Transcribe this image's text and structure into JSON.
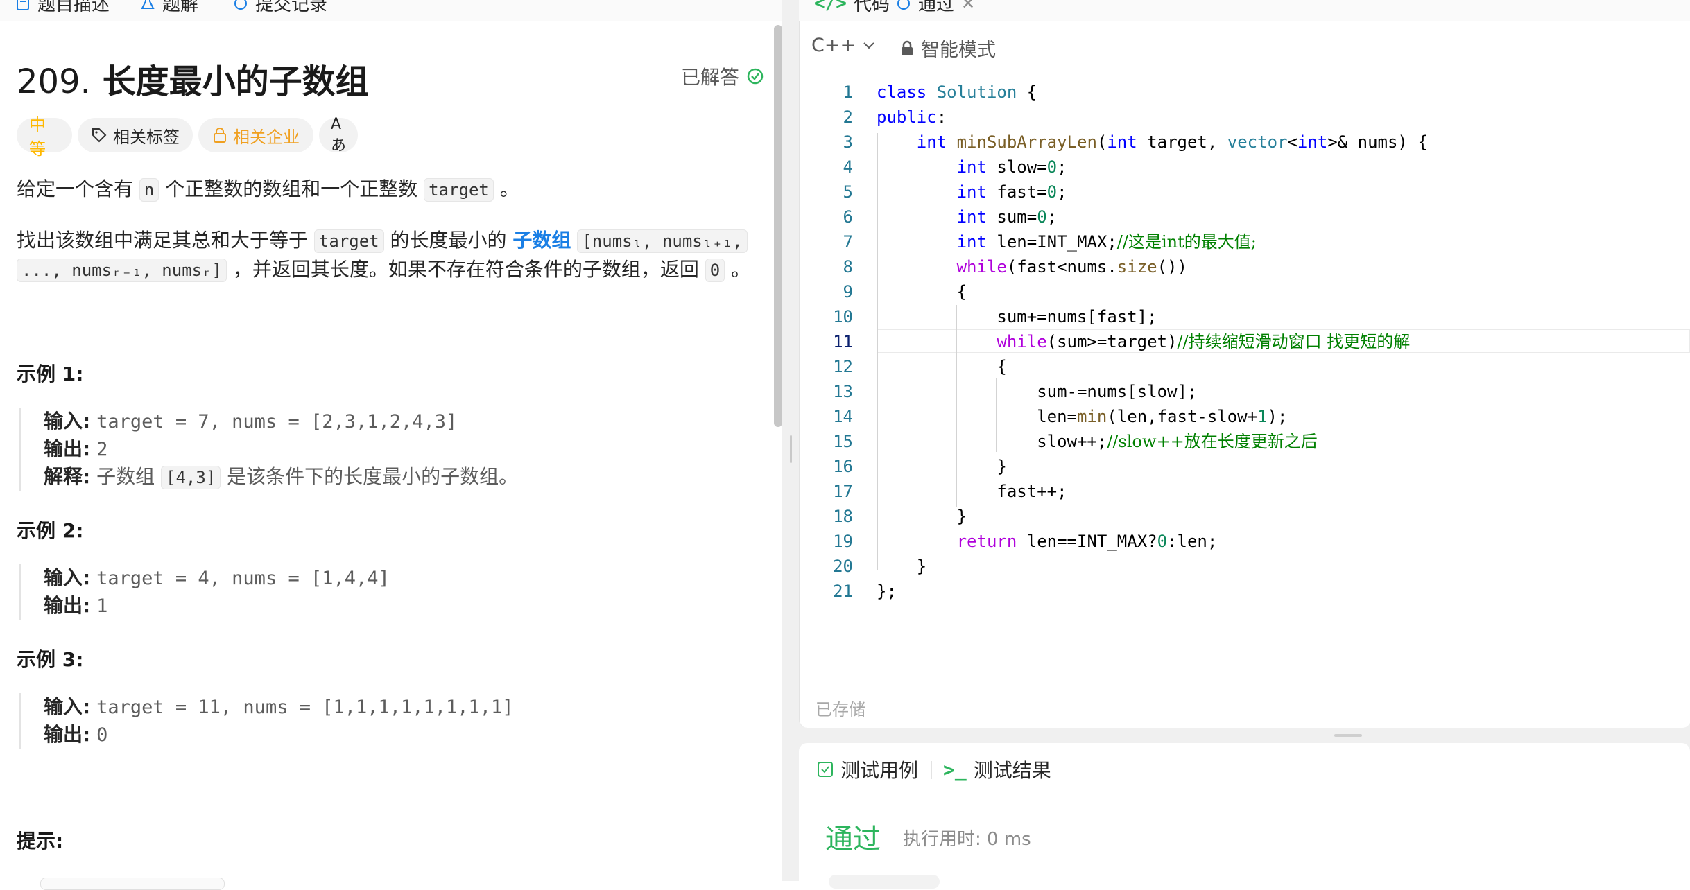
{
  "left_tabs": [
    "题目描述",
    "题解",
    "提交记录"
  ],
  "problem": {
    "number": "209.",
    "title": "长度最小的子数组",
    "status": "已解答",
    "difficulty": "中等",
    "tag_label": "相关标签",
    "company_label": "相关企业",
    "translate_label": "Aあ",
    "desc1": [
      "给定一个含有 ",
      "n",
      " 个正整数的数组和一个正整数 ",
      "target",
      " 。"
    ],
    "desc2": [
      "找出该数组中满足其总和大于等于 ",
      "target",
      " 的长度最小的 ",
      "子数组",
      " "
    ],
    "desc2_code": "[numsₗ, numsₗ₊₁,",
    "desc3_code": "..., numsᵣ₋₁, numsᵣ]",
    "desc3": [
      " ，并返回其长度。如果不存在符合条件的子数组，返回 ",
      "0",
      " 。"
    ]
  },
  "examples": [
    {
      "heading": "示例 1:",
      "input_label": "输入:",
      "input": "target = 7, nums = [2,3,1,2,4,3]",
      "output_label": "输出:",
      "output": "2",
      "explain_label": "解释:",
      "explain_pre": "子数组 ",
      "explain_code": "[4,3]",
      "explain_post": " 是该条件下的长度最小的子数组。"
    },
    {
      "heading": "示例 2:",
      "input_label": "输入:",
      "input": "target = 4, nums = [1,4,4]",
      "output_label": "输出:",
      "output": "1"
    },
    {
      "heading": "示例 3:",
      "input_label": "输入:",
      "input": "target = 11, nums = [1,1,1,1,1,1,1,1]",
      "output_label": "输出:",
      "output": "0"
    }
  ],
  "hint_heading": "提示:",
  "editor": {
    "tab_code": "代码",
    "tab_pass": "通过",
    "language": "C++",
    "mode": "智能模式",
    "saved": "已存储",
    "line_numbers": [
      "1",
      "2",
      "3",
      "4",
      "5",
      "6",
      "7",
      "8",
      "9",
      "10",
      "11",
      "12",
      "13",
      "14",
      "15",
      "16",
      "17",
      "18",
      "19",
      "20",
      "21"
    ],
    "current_line": "11"
  },
  "results": {
    "tab_testcase": "测试用例",
    "tab_result": "测试结果",
    "verdict": "通过",
    "runtime": "执行用时: 0 ms"
  },
  "colors": {
    "accent_blue": "#1a7fe5",
    "pass_green": "#2db55d",
    "medium_orange": "#ffb800",
    "company_orange": "#f0a020"
  }
}
